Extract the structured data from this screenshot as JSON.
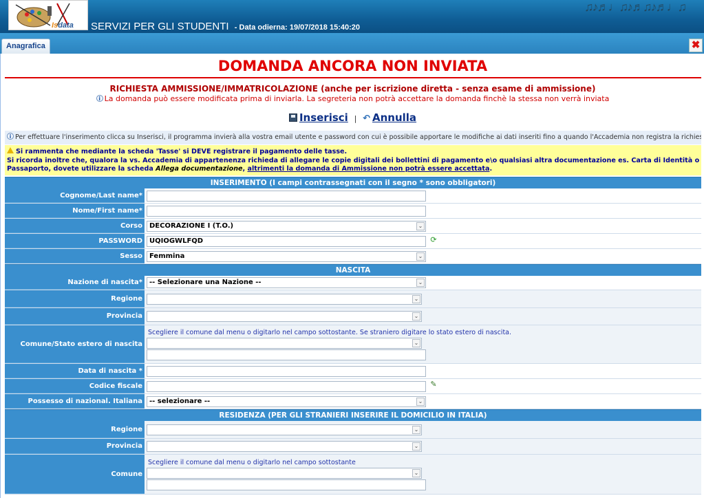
{
  "header": {
    "logo_text_pre": "Is",
    "logo_text_post": "data",
    "app_title": "SERVIZI PER GLI STUDENTI",
    "date_label": "- Data odierna: 19/07/2018 15:40:20"
  },
  "tabs": [
    {
      "label": "Anagrafica"
    }
  ],
  "close_glyph": "✖",
  "status_title": "DOMANDA ANCORA NON INVIATA",
  "subtitle": "RICHIESTA AMMISSIONE/IMMATRICOLAZIONE (anche per iscrizione diretta - senza esame di ammissione)",
  "subnote": "La domanda può essere modificata prima di inviarla. La segreteria non potrà accettare la domanda finchè la stessa non verrà inviata",
  "actions": {
    "insert_label": "Inserisci",
    "separator": "|",
    "cancel_label": "Annulla"
  },
  "info_text": "Per effettuare l'inserimento clicca su Inserisci, il programma invierà alla vostra email utente e password con cui è possibile apportare le modifiche ai dati inseriti fino a quando l'Accademia non registra la richiesta.",
  "warning": {
    "line1": "Si rammenta che mediante la scheda 'Tasse' si DEVE registrare il pagamento delle tasse.",
    "line2_a": "Si ricorda inoltre che, qualora la vs. Accademia di appartenenza richieda di allegare le copie digitali dei bollettini di pagamento e\\o qualsiasi altra documentazione es. Carta di Identità o Passaporto, dovete utilizzare la scheda ",
    "line2_italic": "Allega documentazione",
    "line2_b": ", ",
    "line2_underline": "altrimenti la domanda di Ammissione non potrà essere accettata",
    "line2_end": "."
  },
  "sections": {
    "inserimento": "INSERIMENTO (I campi contrassegnati con il segno * sono obbligatori)",
    "nascita": "NASCITA",
    "residenza": "RESIDENZA (PER GLI STRANIERI INSERIRE IL DOMICILIO IN ITALIA)"
  },
  "fields": {
    "cognome": {
      "label": "Cognome/Last name*",
      "value": ""
    },
    "nome": {
      "label": "Nome/First name*",
      "value": ""
    },
    "corso": {
      "label": "Corso",
      "value": "DECORAZIONE I (T.O.)"
    },
    "password": {
      "label": "PASSWORD",
      "value": "UQIOGWLFQD"
    },
    "sesso": {
      "label": "Sesso",
      "value": "Femmina"
    },
    "nazione": {
      "label": "Nazione di nascita*",
      "value": "-- Selezionare una Nazione --"
    },
    "regione_nascita": {
      "label": "Regione",
      "value": ""
    },
    "provincia_nascita": {
      "label": "Provincia",
      "value": ""
    },
    "comune_nascita": {
      "label": "Comune/Stato estero di nascita",
      "hint": "Scegliere il comune dal menu o digitarlo nel campo sottostante. Se straniero digitare lo stato estero di nascita.",
      "value": ""
    },
    "data_nascita": {
      "label": "Data di nascita *",
      "value": ""
    },
    "codice_fiscale": {
      "label": "Codice fiscale",
      "value": ""
    },
    "nazionalita": {
      "label": "Possesso di nazional. Italiana",
      "value": "-- selezionare --"
    },
    "regione_res": {
      "label": "Regione",
      "value": ""
    },
    "provincia_res": {
      "label": "Provincia",
      "value": ""
    },
    "comune_res": {
      "label": "Comune",
      "hint": "Scegliere il comune dal menu o digitarlo nel campo sottostante",
      "value": ""
    }
  },
  "icons": {
    "refresh": "refresh-password-icon",
    "edit": "calculate-fiscal-code-icon",
    "chevron": "chevron-down-icon"
  }
}
